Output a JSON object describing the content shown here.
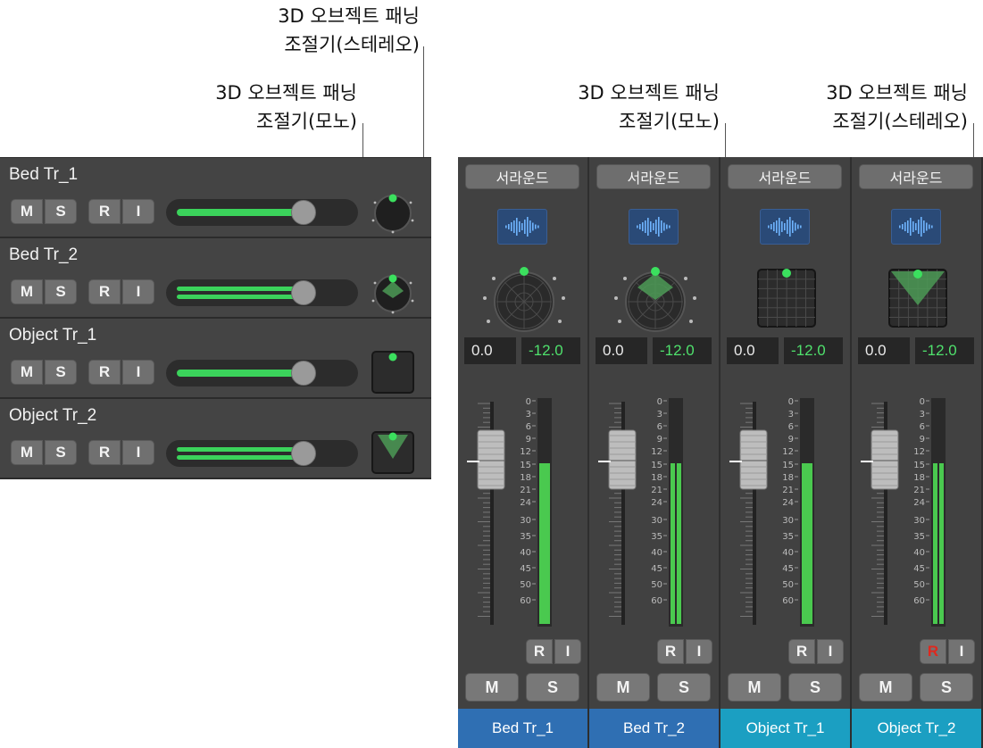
{
  "callouts": {
    "stereo_left": {
      "line1": "3D 오브젝트 패닝",
      "line2": "조절기(스테레오)"
    },
    "mono_left": {
      "line1": "3D 오브젝트 패닝",
      "line2": "조절기(모노)"
    },
    "mono_right": {
      "line1": "3D 오브젝트 패닝",
      "line2": "조절기(모노)"
    },
    "stereo_right": {
      "line1": "3D 오브젝트 패닝",
      "line2": "조절기(스테레오)"
    }
  },
  "tracks": [
    {
      "name": "Bed Tr_1",
      "mute": "M",
      "solo": "S",
      "record": "R",
      "input": "I",
      "panner": "surround-mono"
    },
    {
      "name": "Bed Tr_2",
      "mute": "M",
      "solo": "S",
      "record": "R",
      "input": "I",
      "panner": "surround-stereo"
    },
    {
      "name": "Object Tr_1",
      "mute": "M",
      "solo": "S",
      "record": "R",
      "input": "I",
      "panner": "object-mono"
    },
    {
      "name": "Object Tr_2",
      "mute": "M",
      "solo": "S",
      "record": "R",
      "input": "I",
      "panner": "object-stereo"
    }
  ],
  "mixer": {
    "strips": [
      {
        "surround_label": "서라운드",
        "volume": "0.0",
        "pan": "-12.0",
        "record": "R",
        "input": "I",
        "mute": "M",
        "solo": "S",
        "name": "Bed Tr_1",
        "name_color": "#2f6fb3",
        "record_armed": false,
        "stereo_meter": false
      },
      {
        "surround_label": "서라운드",
        "volume": "0.0",
        "pan": "-12.0",
        "record": "R",
        "input": "I",
        "mute": "M",
        "solo": "S",
        "name": "Bed Tr_2",
        "name_color": "#2f6fb3",
        "record_armed": false,
        "stereo_meter": true
      },
      {
        "surround_label": "서라운드",
        "volume": "0.0",
        "pan": "-12.0",
        "record": "R",
        "input": "I",
        "mute": "M",
        "solo": "S",
        "name": "Object Tr_1",
        "name_color": "#1b9fc2",
        "record_armed": false,
        "stereo_meter": false
      },
      {
        "surround_label": "서라운드",
        "volume": "0.0",
        "pan": "-12.0",
        "record": "R",
        "input": "I",
        "mute": "M",
        "solo": "S",
        "name": "Object Tr_2",
        "name_color": "#1b9fc2",
        "record_armed": true,
        "stereo_meter": true
      }
    ],
    "meter_scale": [
      "0",
      "3",
      "6",
      "9",
      "12",
      "15",
      "18",
      "21",
      "24",
      "30",
      "35",
      "40",
      "45",
      "50",
      "60"
    ]
  },
  "colors": {
    "accent_green": "#3bd35b",
    "record_red": "#e0281e"
  }
}
